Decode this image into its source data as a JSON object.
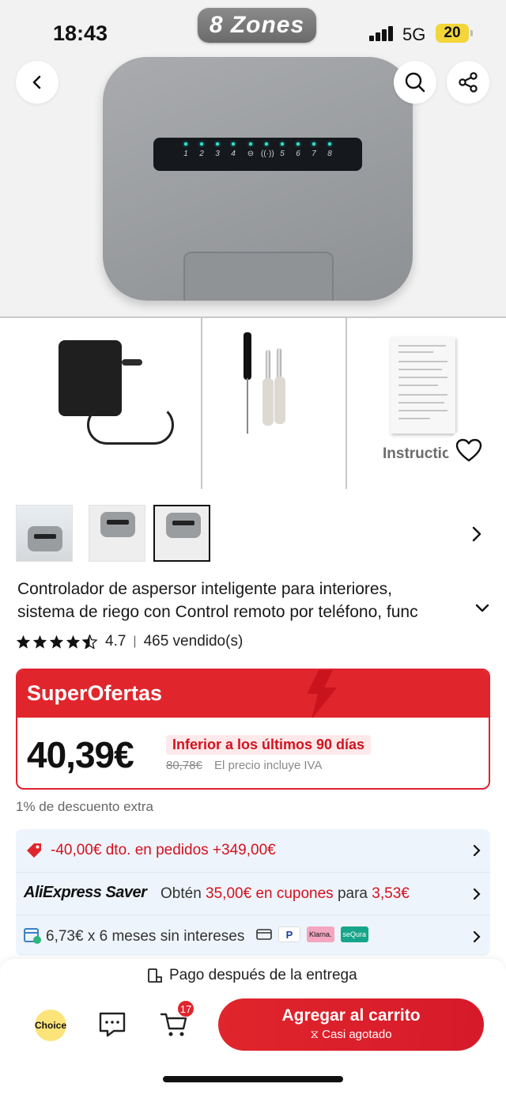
{
  "status_bar": {
    "time": "18:43",
    "network": "5G",
    "battery": "20"
  },
  "hero": {
    "badge": "8 Zones",
    "panel_numbers": [
      "1",
      "2",
      "3",
      "4",
      "",
      "",
      "5",
      "6",
      "7",
      "8"
    ]
  },
  "accessories": {
    "manual_label": "Instructio"
  },
  "product": {
    "title_line1": "Controlador de aspersor inteligente para interiores,",
    "title_line2": "sistema de riego con Control remoto por teléfono, func",
    "rating": "4.7",
    "sold": "465 vendido(s)"
  },
  "deal": {
    "banner": "SuperOfertas",
    "price": "40,39€",
    "lowest_label": "Inferior a los últimos 90 días",
    "old_price": "80,78€",
    "tax_note": "El precio incluye IVA"
  },
  "extra_discount": "1% de descuento extra",
  "promos": {
    "coupon": "-40,00€ dto. en pedidos +349,00€",
    "saver_logo": "AliExpress Saver",
    "saver_pre": "Obtén",
    "saver_amount": "35,00€ en cupones",
    "saver_mid": "para",
    "saver_price": "3,53€",
    "installments": "6,73€ x 6 meses sin intereses",
    "pay_badges": [
      "Klarna.",
      "seQura"
    ]
  },
  "bottom_bar": {
    "pay_after": "Pago después de la entrega",
    "choice": "Choice",
    "cart_count": "17",
    "add_to_cart": "Agregar al carrito",
    "stock_note": "Casi agotado"
  },
  "colors": {
    "accent": "#e1252c",
    "promo_bg": "#eef4fb",
    "badge_gray": "#7a7a7a"
  }
}
